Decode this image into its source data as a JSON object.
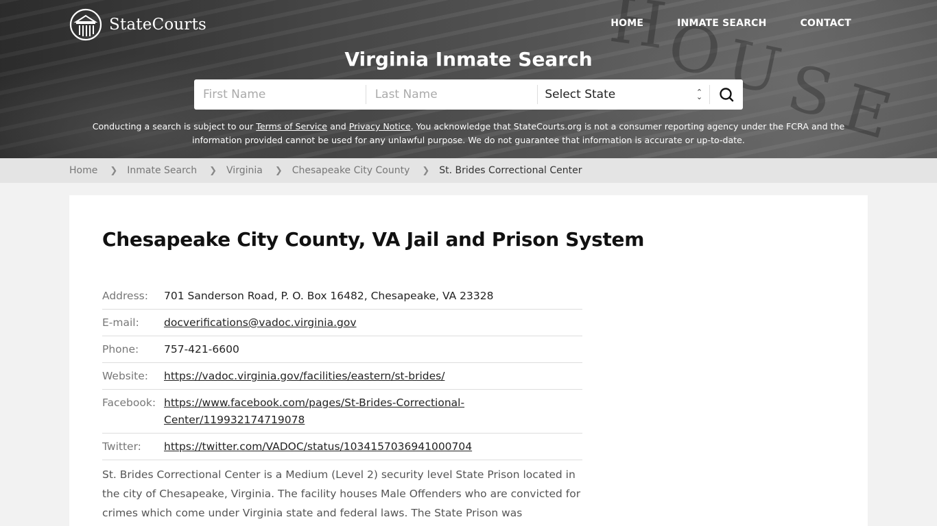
{
  "header": {
    "logo_text": "StateCourts",
    "nav": [
      {
        "label": "HOME"
      },
      {
        "label": "INMATE SEARCH"
      },
      {
        "label": "CONTACT"
      }
    ],
    "hero_title": "Virginia Inmate Search"
  },
  "search": {
    "first_name_placeholder": "First Name",
    "last_name_placeholder": "Last Name",
    "state_selected": "Select State",
    "search_icon": "search-icon"
  },
  "disclaimer": {
    "part1": "Conducting a search is subject to our ",
    "terms_link": "Terms of Service",
    "part2": " and ",
    "privacy_link": "Privacy Notice",
    "part3": ". You acknowledge that StateCourts.org is not a consumer reporting agency under the FCRA and the information provided cannot be used for any unlawful purpose. We do not guarantee that information is accurate or up-to-date."
  },
  "breadcrumb": [
    {
      "label": "Home"
    },
    {
      "label": "Inmate Search"
    },
    {
      "label": "Virginia"
    },
    {
      "label": "Chesapeake City County"
    },
    {
      "label": "St. Brides Correctional Center"
    }
  ],
  "main": {
    "title": "Chesapeake City County, VA Jail and Prison System",
    "info": [
      {
        "label": "Address:",
        "value": "701 Sanderson Road, P. O. Box 16482, Chesapeake, VA 23328",
        "link": false
      },
      {
        "label": "E-mail:",
        "value": "docverifications@vadoc.virginia.gov",
        "link": true
      },
      {
        "label": "Phone:",
        "value": "757-421-6600",
        "link": false
      },
      {
        "label": "Website:",
        "value": "https://vadoc.virginia.gov/facilities/eastern/st-brides/",
        "link": true
      },
      {
        "label": "Facebook:",
        "value": "https://www.facebook.com/pages/St-Brides-Correctional-Center/119932174719078",
        "link": true
      },
      {
        "label": "Twitter:",
        "value": "https://twitter.com/VADOC/status/1034157036941000704",
        "link": true
      }
    ],
    "description": "St. Brides Correctional Center is a Medium (Level 2) security level State Prison located in the city of Chesapeake, Virginia. The facility houses Male Offenders who are convicted for crimes which come under Virginia state and federal laws. The State Prison was"
  }
}
